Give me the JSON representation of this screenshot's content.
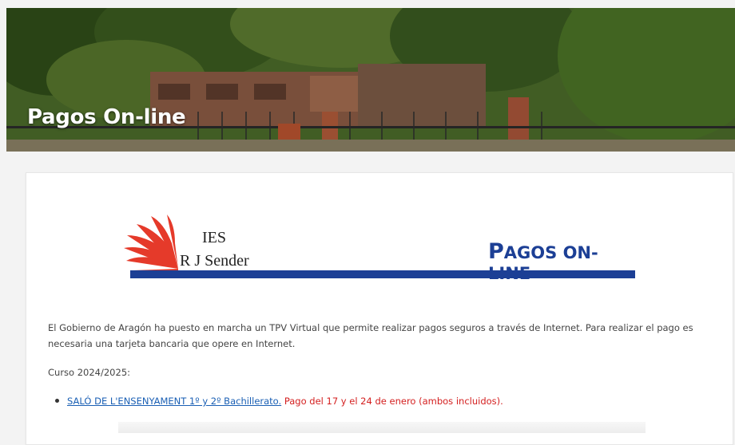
{
  "hero": {
    "title": "Pagos On-line"
  },
  "logo": {
    "school_line1": "IES",
    "school_line2": "R J Sender",
    "pagos_first": "P",
    "pagos_rest": "AGOS ON-LINE",
    "brand_color": "#1c3f95",
    "accent_color": "#e53a2a"
  },
  "content": {
    "intro": "El Gobierno de Aragón ha puesto en marcha un TPV Virtual que permite realizar pagos seguros a través de Internet. Para realizar el pago es necesaria una tarjeta bancaria que opere en Internet.",
    "curso": "Curso 2024/2025:",
    "items": [
      {
        "link": "SALÓ DE L'ENSENYAMENT 1º y 2º Bachillerato.",
        "note": " Pago del 17 y el 24 de enero (ambos incluidos)."
      }
    ],
    "link_color": "#1a5fb4",
    "note_color": "#d42020"
  }
}
